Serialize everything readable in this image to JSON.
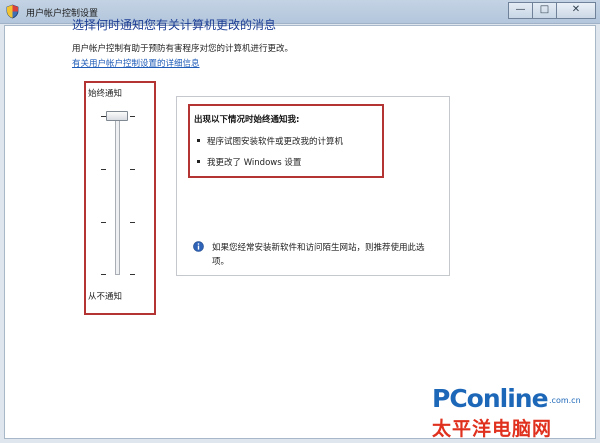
{
  "window": {
    "title": "用户帐户控制设置",
    "controls": {
      "minimize": "—",
      "maximize": "□",
      "close": "✕"
    }
  },
  "main": {
    "heading": "选择何时通知您有关计算机更改的消息",
    "description": "用户帐户控制有助于预防有害程序对您的计算机进行更改。",
    "help_link": "有关用户帐户控制设置的详细信息"
  },
  "slider": {
    "label_top": "始终通知",
    "label_bottom": "从不通知",
    "levels": 4,
    "selected_level": 1
  },
  "info": {
    "title": "出现以下情况时始终通知我:",
    "bullets": [
      "程序试图安装软件或更改我的计算机",
      "我更改了 Windows 设置"
    ],
    "note": "如果您经常安装新软件和访问陌生网站，则推荐使用此选项。"
  },
  "watermark": {
    "main": "PConline",
    "domain": ".com.cn",
    "sub": "太平洋电脑网"
  },
  "colors": {
    "highlight_frame": "#b43434",
    "heading": "#1e3f95",
    "link": "#1f5cb8",
    "logo_blue": "#1d67b8",
    "logo_red": "#e0301e"
  },
  "icons": {
    "title": "shield-icon",
    "note": "info-icon"
  }
}
